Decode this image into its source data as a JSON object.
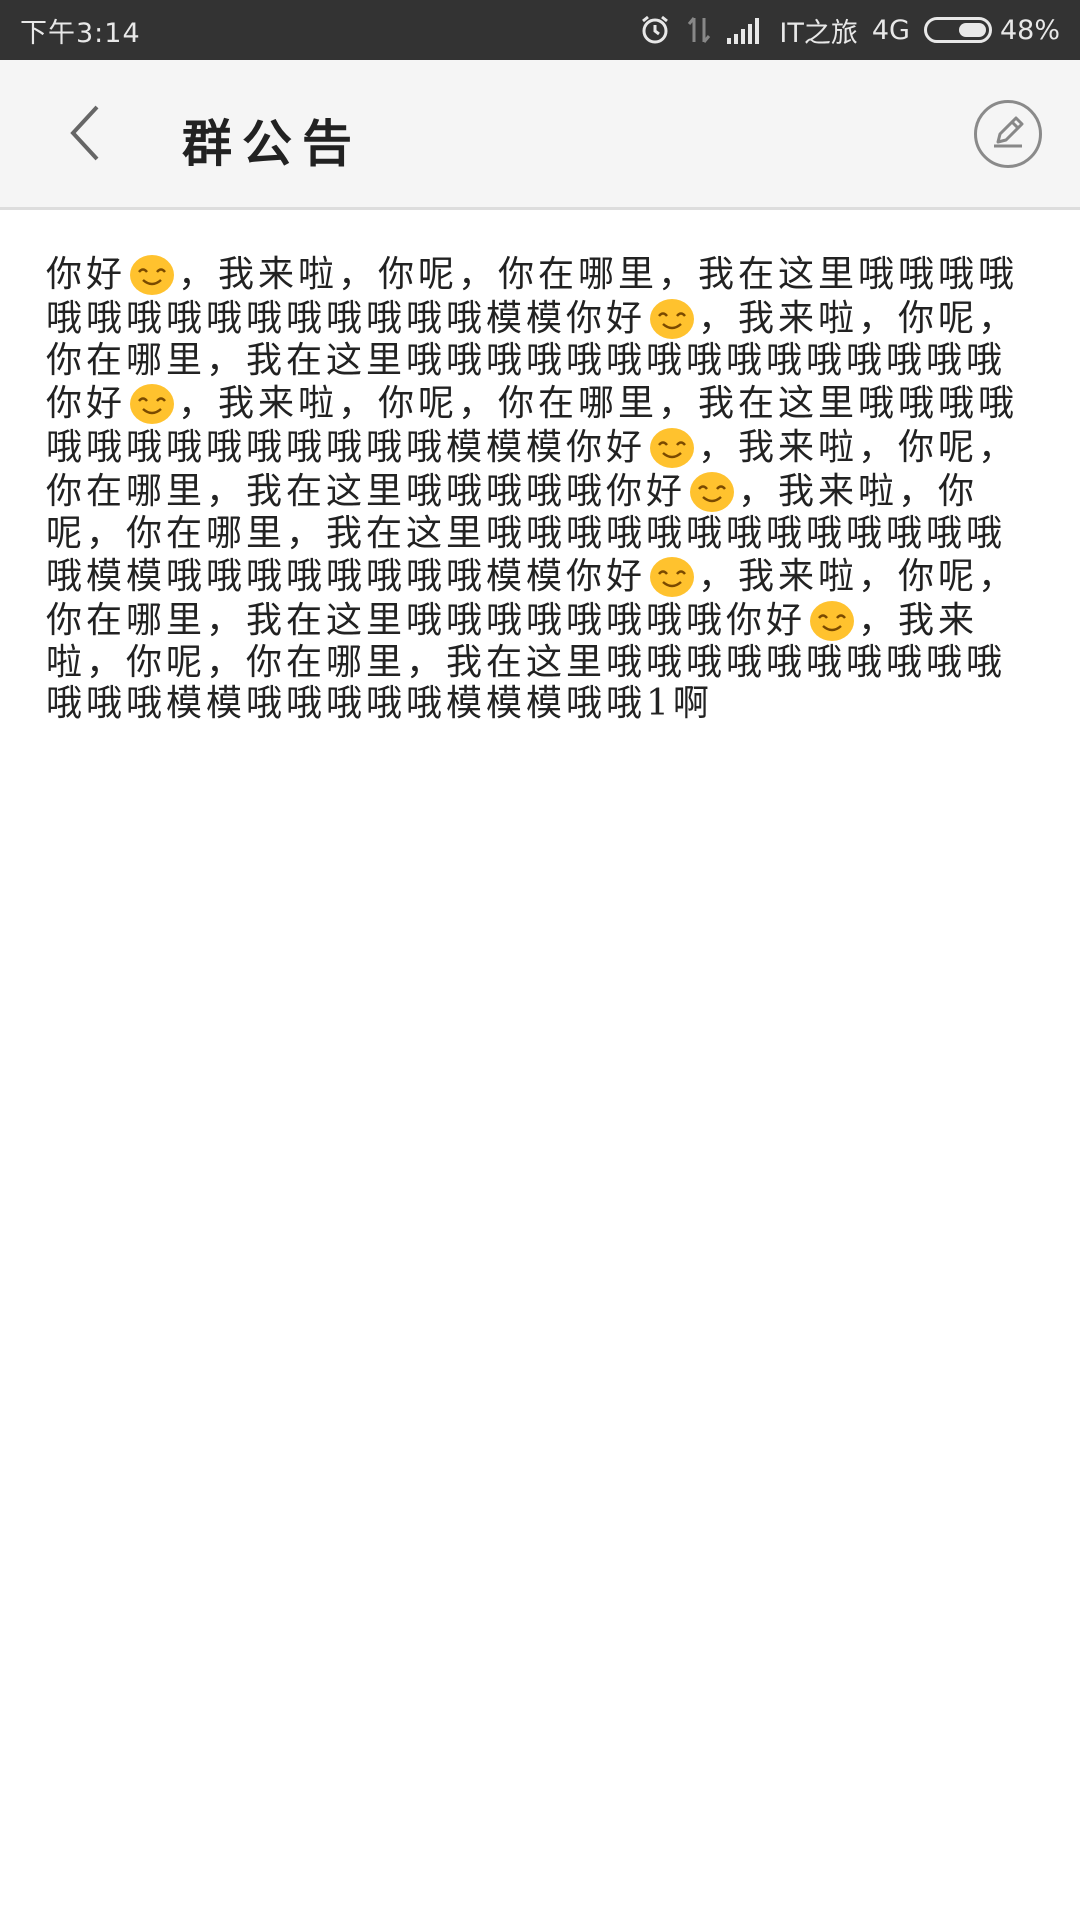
{
  "status_bar": {
    "time": "下午3:14",
    "carrier": "IT之旅",
    "network": "4G",
    "battery": "48%",
    "battery_level": 0.48,
    "icons": [
      "alarm-icon",
      "data-transfer-icon",
      "signal-icon",
      "battery-icon"
    ]
  },
  "app_bar": {
    "title": "群公告",
    "back_icon": "chevron-left-icon",
    "edit_icon": "pencil-icon"
  },
  "announcement": {
    "segments": [
      "你好",
      "[emoji]",
      "，我来啦，你呢，你在哪里，我在这里哦哦哦哦哦哦哦哦哦哦哦哦哦哦哦模模你好",
      "[emoji]",
      "，我来啦，你呢，你在哪里，我在这里哦哦哦哦哦哦哦哦哦哦哦哦哦哦哦你好",
      "[emoji]",
      "，我来啦，你呢，你在哪里，我在这里哦哦哦哦哦哦哦哦哦哦哦哦哦哦模模模你好",
      "[emoji]",
      "，我来啦，你呢，你在哪里，我在这里哦哦哦哦哦你好",
      "[emoji]",
      "，我来啦，你呢，你在哪里，我在这里哦哦哦哦哦哦哦哦哦哦哦哦哦哦模模哦哦哦哦哦哦哦哦模模你好",
      "[emoji]",
      "，我来啦，你呢，你在哪里，我在这里哦哦哦哦哦哦哦哦你好",
      "[emoji]",
      "，我来啦，你呢，你在哪里，我在这里哦哦哦哦哦哦哦哦哦哦哦哦哦模模哦哦哦哦哦模模模哦哦1啊"
    ],
    "emoji_icon": "smiling-face-icon",
    "emoji_color": "#FFC22E"
  }
}
